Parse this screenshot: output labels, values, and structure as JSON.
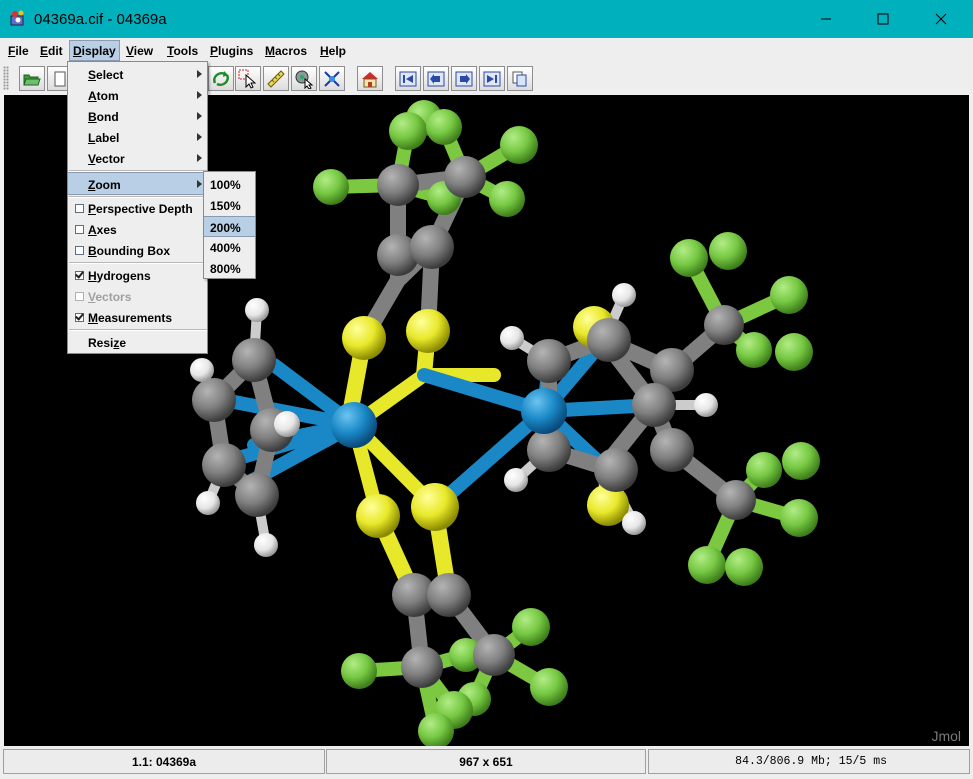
{
  "window": {
    "title": "04369a.cif - 04369a"
  },
  "menubar": [
    {
      "id": "file",
      "pre": "",
      "mn": "F",
      "post": "ile"
    },
    {
      "id": "edit",
      "pre": "",
      "mn": "E",
      "post": "dit"
    },
    {
      "id": "display",
      "pre": "",
      "mn": "D",
      "post": "isplay"
    },
    {
      "id": "view",
      "pre": "",
      "mn": "V",
      "post": "iew"
    },
    {
      "id": "tools",
      "pre": "",
      "mn": "T",
      "post": "ools"
    },
    {
      "id": "plugins",
      "pre": "",
      "mn": "P",
      "post": "lugins"
    },
    {
      "id": "macros",
      "pre": "",
      "mn": "M",
      "post": "acros"
    },
    {
      "id": "help",
      "pre": "",
      "mn": "H",
      "post": "elp"
    }
  ],
  "display_menu": {
    "items": [
      {
        "pre": "",
        "mn": "S",
        "post": "elect"
      },
      {
        "pre": "",
        "mn": "A",
        "post": "tom"
      },
      {
        "pre": "",
        "mn": "B",
        "post": "ond"
      },
      {
        "pre": "",
        "mn": "L",
        "post": "abel"
      },
      {
        "pre": "",
        "mn": "V",
        "post": "ector"
      },
      {
        "pre": "",
        "mn": "Z",
        "post": "oom"
      },
      {
        "pre": "",
        "mn": "P",
        "post": "erspective Depth"
      },
      {
        "pre": "",
        "mn": "A",
        "post": "xes"
      },
      {
        "pre": "",
        "mn": "B",
        "post": "ounding Box"
      },
      {
        "pre": "",
        "mn": "H",
        "post": "ydrogens"
      },
      {
        "pre": "",
        "mn": "V",
        "post": "ectors"
      },
      {
        "pre": "",
        "mn": "M",
        "post": "easurements"
      },
      {
        "pre": "Resi",
        "mn": "z",
        "post": "e"
      }
    ]
  },
  "zoom_menu": {
    "items": [
      "100%",
      "150%",
      "200%",
      "400%",
      "800%"
    ],
    "selected": "200%"
  },
  "viewer": {
    "watermark": "Jmol"
  },
  "status": {
    "model": "1.1: 04369a",
    "size": "967 x 651",
    "memory": "84.3/806.9 Mb;  15/5 ms"
  },
  "colors": {
    "titlebar": "#00b1bd",
    "highlight": "#b8cfe5",
    "carbon": "#808080",
    "fluorine": "#76c843",
    "sulfur": "#e8e82a",
    "hydrogen": "#ffffff",
    "metal": "#1a88c7"
  }
}
